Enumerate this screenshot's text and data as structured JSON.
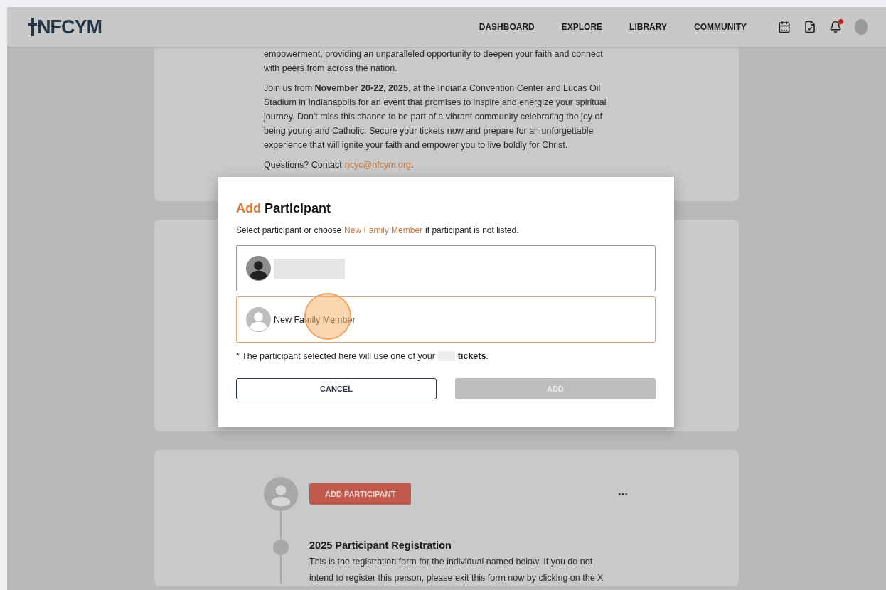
{
  "header": {
    "logo": "NFCYM",
    "nav": [
      {
        "label": "DASHBOARD"
      },
      {
        "label": "EXPLORE"
      },
      {
        "label": "LIBRARY"
      },
      {
        "label": "COMMUNITY"
      }
    ],
    "notifications_unread": true
  },
  "event_card": {
    "paragraphs": [
      "empowerment, providing an unparalleled opportunity to deepen your faith and connect with peers from across the nation.",
      "Join us from **November 20-22, 2025**, at the Indiana Convention Center and Lucas Oil Stadium in Indianapolis for an event that promises to inspire and energize your spiritual journey. Don't miss this chance to be part of a vibrant community celebrating the joy of being young and Catholic. Secure your tickets now and prepare for an unforgettable experience that will ignite your faith and empower you to live boldly for Christ."
    ],
    "contact": {
      "prefix": "Questions? Contact",
      "link": "ncyc@nfcym.org",
      "suffix": "."
    }
  },
  "registration_card": {
    "add_button": "ADD PARTICIPANT",
    "step_title": "2025 Participant Registration",
    "step_lines": [
      "This is the registration form for the individual named below. If you do not",
      "intend to register this person, please exit this form now by clicking on the X"
    ]
  },
  "modal": {
    "title_accent": "Add",
    "title_rest": "Participant",
    "intro_before": "Select participant or choose",
    "intro_link": "New Family Member",
    "intro_after": "if participant is not listed.",
    "options": [
      {
        "kind": "member",
        "selected": false
      },
      {
        "kind": "new",
        "label": "New Family Member",
        "selected": true
      }
    ],
    "note_before": "* The participant selected here will use one of your",
    "note_bold": "tickets",
    "note_after": ".",
    "cancel": "CANCEL",
    "add": {
      "label": "ADD",
      "disabled": true
    }
  }
}
